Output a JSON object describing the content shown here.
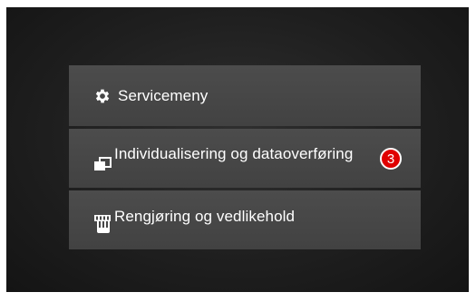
{
  "menu": {
    "items": [
      {
        "label": "Servicemeny",
        "icon": "gear-icon"
      },
      {
        "label": "Individualisering og dataoverføring",
        "icon": "data-transfer-icon",
        "badge": "3"
      },
      {
        "label": "Rengjøring og vedlikehold",
        "icon": "cleaning-hand-icon"
      }
    ]
  },
  "colors": {
    "background": "#1f1f1f",
    "item": "#474747",
    "badge": "#e00000",
    "text": "#ffffff"
  }
}
